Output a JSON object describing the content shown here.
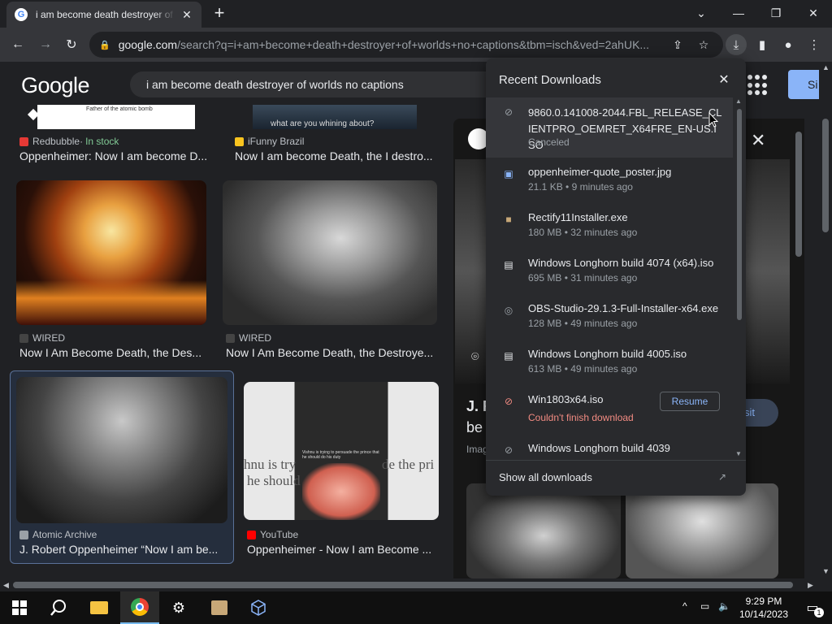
{
  "window": {
    "tab_title": "i am become death destroyer of worlds no captions - Google Search",
    "tab_favicon": "G",
    "new_tab": "+"
  },
  "toolbar": {
    "url_domain": "google.com",
    "url_path": "/search?q=i+am+become+death+destroyer+of+worlds+no+captions&tbm=isch&ved=2ahUK..."
  },
  "google": {
    "logo": "Google",
    "query": "i am become death destroyer of worlds no captions",
    "signin": "Si"
  },
  "results": [
    {
      "source": "Redbubble",
      "stock_sep": " · ",
      "stock": "In stock",
      "title": "Oppenheimer: Now I am become D...",
      "caption_text": "Father of the atomic bomb"
    },
    {
      "source": "iFunny Brazil",
      "title": "Now I am become Death, the I destro...",
      "caption_text": "what are you whining about?"
    },
    {
      "source": "WIRED",
      "title": "Now I Am Become Death, the Des..."
    },
    {
      "source": "WIRED",
      "title": "Now I Am Become Death, the Destroye..."
    },
    {
      "source": "Atomic Archive",
      "title": "J. Robert Oppenheimer “Now I am be..."
    },
    {
      "source": "YouTube",
      "title": "Oppenheimer - Now I am Become ...",
      "caption_left": "hnu is try",
      "caption_right": "de the pri",
      "caption_left2": "he should",
      "small_caption": "Vishnu is trying to persuade the prince that he should do his duty"
    }
  ],
  "side_panel": {
    "title_line1": "J. R",
    "title_line2": "be",
    "meta": "Imag",
    "visit": "sit"
  },
  "downloads": {
    "header": "Recent Downloads",
    "items": [
      {
        "name": "9860.0.141008-2044.FBL_RELEASE_CLIENTPRO_OEMRET_X64FRE_EN-US.ISO",
        "meta": "Canceled",
        "icon": "canceled-file-icon"
      },
      {
        "name": "oppenheimer-quote_poster.jpg",
        "meta": "21.1 KB • 9 minutes ago",
        "icon": "image-file-icon"
      },
      {
        "name": "Rectify11Installer.exe",
        "meta": "180 MB • 32 minutes ago",
        "icon": "installer-icon"
      },
      {
        "name": "Windows Longhorn build 4074 (x64).iso",
        "meta": "695 MB • 31 minutes ago",
        "icon": "iso-file-icon"
      },
      {
        "name": "OBS-Studio-29.1.3-Full-Installer-x64.exe",
        "meta": "128 MB • 49 minutes ago",
        "icon": "obs-icon"
      },
      {
        "name": "Windows Longhorn build 4005.iso",
        "meta": "613 MB • 49 minutes ago",
        "icon": "iso-file-icon"
      },
      {
        "name": "Win1803x64.iso",
        "meta": "Couldn't finish download",
        "icon": "failed-file-icon",
        "action": "Resume"
      },
      {
        "name": "Windows Longhorn build 4039",
        "meta": "",
        "icon": "canceled-file-icon"
      }
    ],
    "footer": "Show all downloads"
  },
  "taskbar": {
    "time": "9:29 PM",
    "date": "10/14/2023",
    "notif_count": "1"
  }
}
